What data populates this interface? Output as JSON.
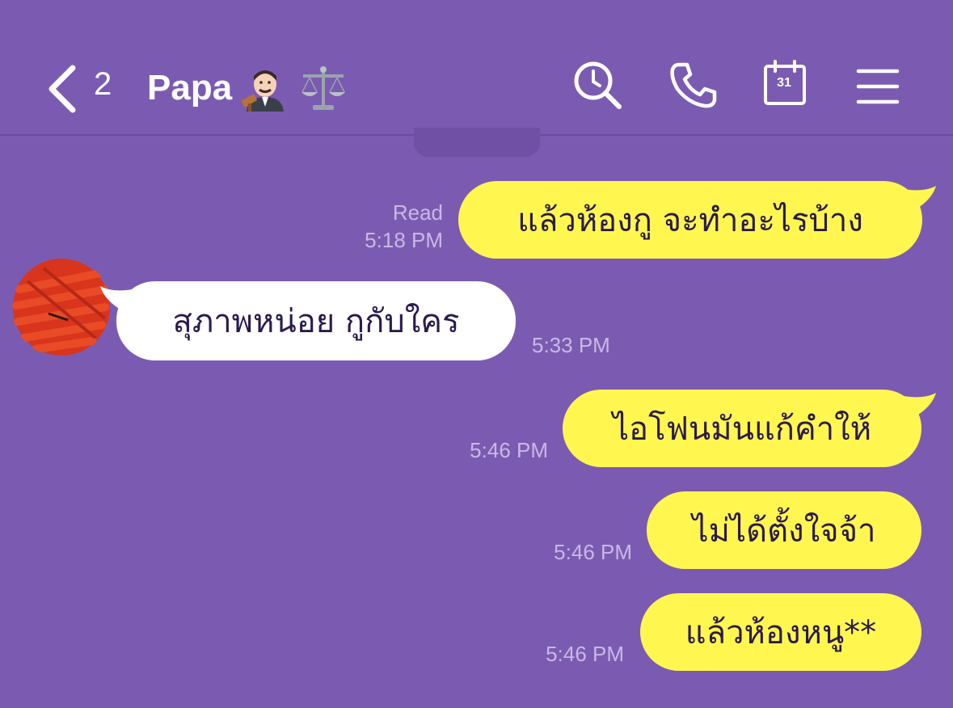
{
  "header": {
    "back_count": "2",
    "title": "Papa",
    "icons": [
      "back-chevron-icon",
      "search-icon",
      "phone-icon",
      "calendar-icon",
      "menu-icon"
    ],
    "calendar_day": "31"
  },
  "messages": [
    {
      "side": "out",
      "text": "แล้วห้องกู จะทำอะไรบ้าง",
      "status": "Read",
      "time": "5:18 PM"
    },
    {
      "side": "in",
      "text": "สุภาพหน่อย กูกับใคร",
      "time": "5:33 PM"
    },
    {
      "side": "out",
      "text": "ไอโฟนมันแก้คำให้",
      "time": "5:46 PM"
    },
    {
      "side": "out",
      "text": "ไม่ได้ตั้งใจจ้า",
      "time": "5:46 PM"
    },
    {
      "side": "out",
      "text": "แล้วห้องหนู**",
      "time": "5:46 PM"
    }
  ],
  "colors": {
    "background": "#7b5bb1",
    "outgoing_bubble": "#fff74f",
    "incoming_bubble": "#ffffff",
    "bubble_text": "#2b1a4e",
    "meta_text": "#c9b8e6"
  }
}
